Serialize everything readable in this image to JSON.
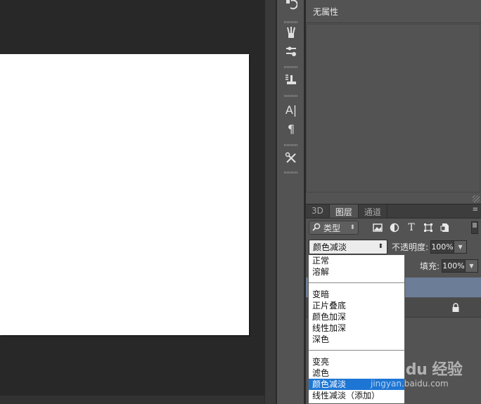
{
  "properties": {
    "no_properties": "无属性"
  },
  "layers_panel": {
    "tabs": [
      {
        "label": "3D"
      },
      {
        "label": "图层"
      },
      {
        "label": "通道"
      }
    ],
    "menu_icon": "≡",
    "filter": {
      "icon": "search-icon",
      "label": "类型"
    },
    "filter_icons": [
      "image-filter-icon",
      "adjustment-filter-icon",
      "type-filter-icon",
      "shape-filter-icon",
      "smart-object-filter-icon"
    ],
    "type_glyph": "T",
    "blend_mode": "颜色减淡",
    "opacity_label": "不透明度:",
    "opacity_value": "100%",
    "fill_label": "填充:",
    "fill_value": "100%"
  },
  "toolstrip": {
    "text_tool": "A|",
    "paragraph_tool": "¶"
  },
  "blend_menu": {
    "groups": [
      [
        "正常",
        "溶解"
      ],
      [
        "变暗",
        "正片叠底",
        "颜色加深",
        "线性加深",
        "深色"
      ],
      [
        "变亮",
        "滤色",
        "颜色减淡",
        "线性减淡（添加）"
      ]
    ],
    "selected": "颜色减淡"
  },
  "watermark": {
    "brand": "Bai du 经验",
    "url": "jingyan.baidu.com"
  },
  "colors": {
    "canvas_bg": "#282828",
    "panel_bg": "#535353",
    "selected_layer": "#6c7d98",
    "selected_option": "#1e76d4"
  }
}
